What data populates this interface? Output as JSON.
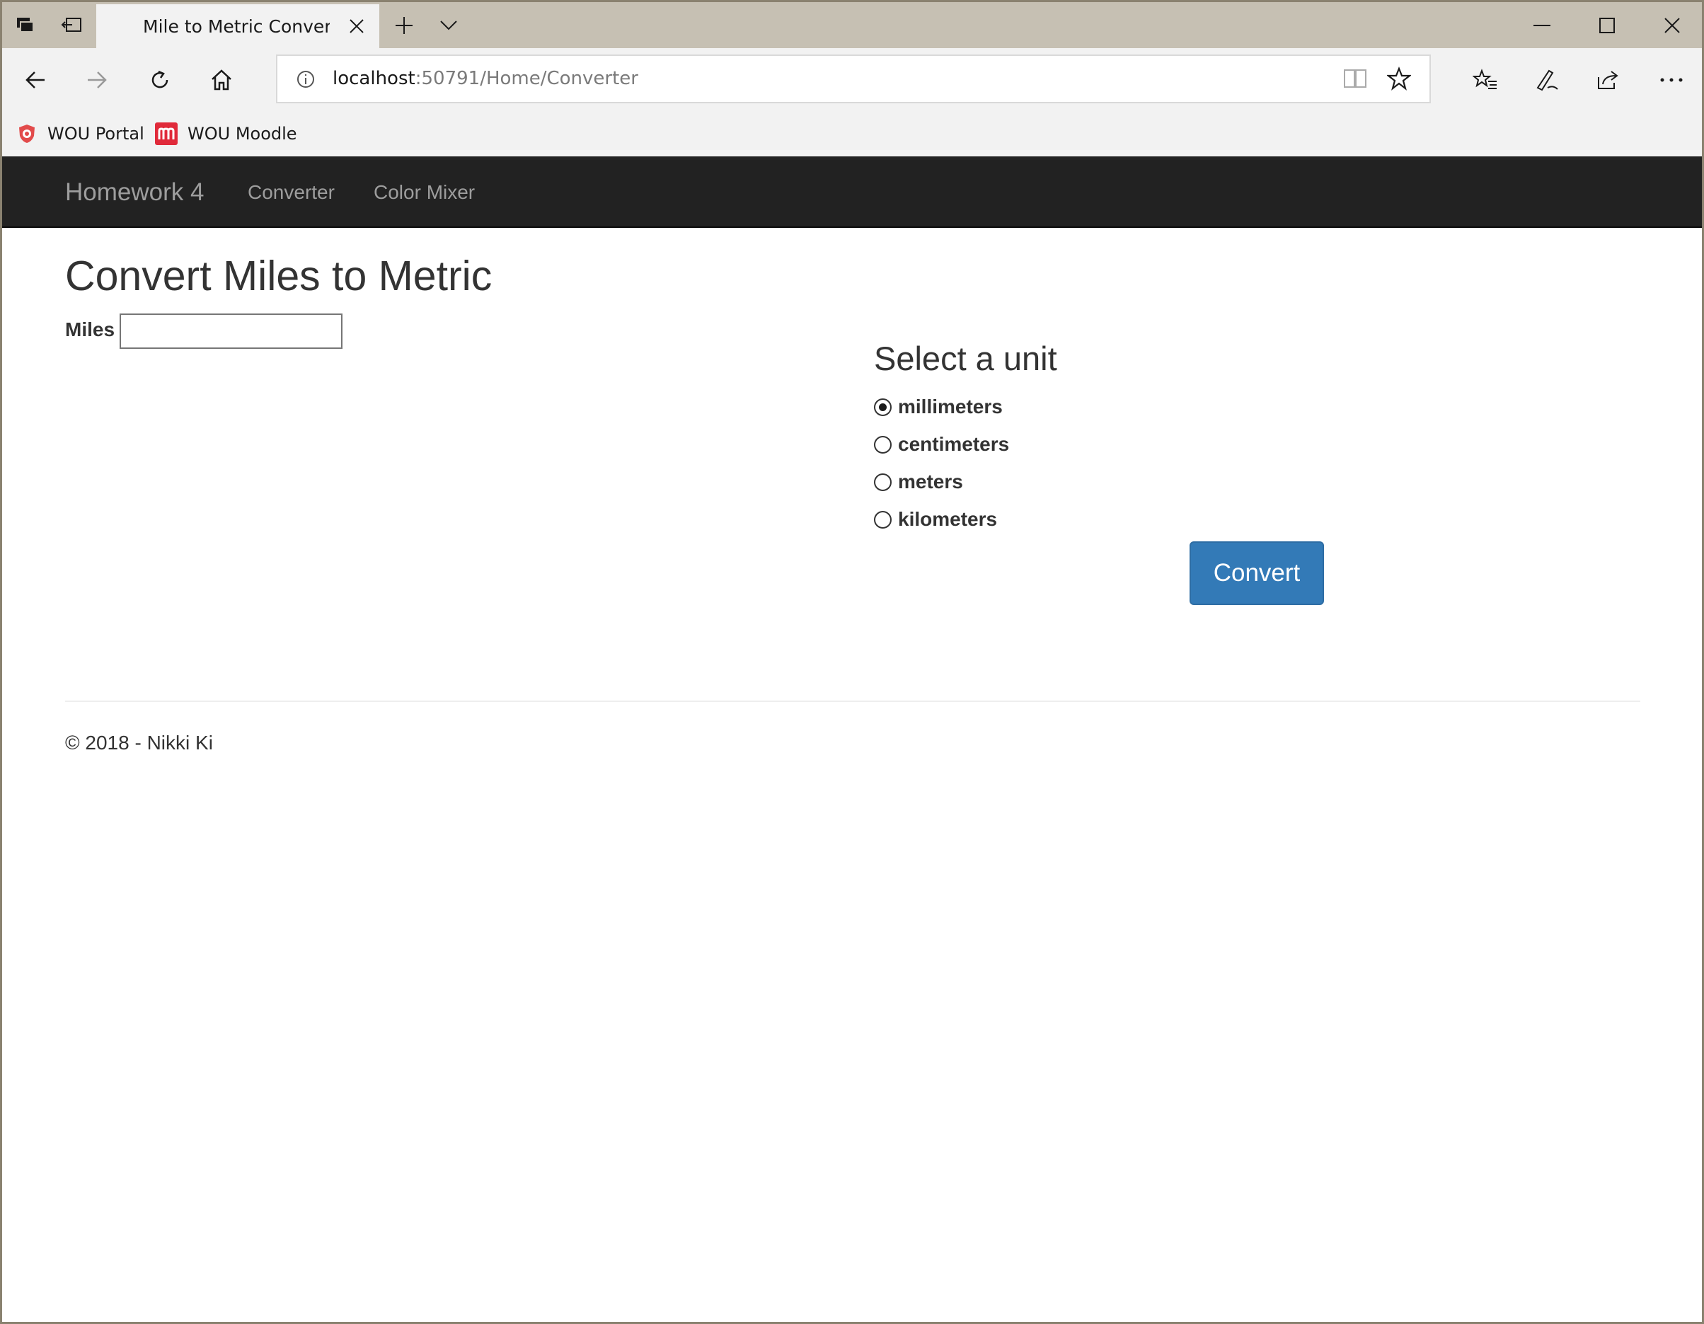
{
  "browser": {
    "tab_title": "Mile to Metric Converte",
    "address": {
      "host": "localhost",
      "path": ":50791/Home/Converter"
    },
    "favorites": [
      {
        "label": "WOU Portal",
        "icon": "wou-portal-icon"
      },
      {
        "label": "WOU Moodle",
        "icon": "moodle-icon"
      }
    ]
  },
  "site": {
    "brand": "Homework 4",
    "nav": [
      "Converter",
      "Color Mixer"
    ]
  },
  "page": {
    "title": "Convert Miles to Metric",
    "miles_label": "Miles",
    "miles_value": "",
    "unit_heading": "Select a unit",
    "units": [
      {
        "label": "millimeters",
        "checked": true
      },
      {
        "label": "centimeters",
        "checked": false
      },
      {
        "label": "meters",
        "checked": false
      },
      {
        "label": "kilometers",
        "checked": false
      }
    ],
    "convert_label": "Convert",
    "footer": "© 2018 - Nikki Ki"
  },
  "colors": {
    "site_nav": "#222222",
    "button": "#337ab7",
    "chrome": "#c6c0b3"
  }
}
